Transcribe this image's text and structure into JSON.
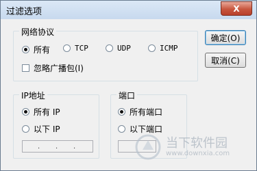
{
  "window": {
    "title": "过滤选项",
    "close_label": "X"
  },
  "protocol_group": {
    "legend": "网络协议",
    "options": [
      {
        "label": "所有",
        "selected": true
      },
      {
        "label": "TCP",
        "selected": false
      },
      {
        "label": "UDP",
        "selected": false
      },
      {
        "label": "ICMP",
        "selected": false
      }
    ],
    "ignore_broadcast_label": "忽略广播包(I)",
    "ignore_broadcast_checked": false
  },
  "ip_group": {
    "legend": "IP地址",
    "all_label": "所有 IP",
    "below_label": "以下 IP",
    "all_selected": true,
    "ip_dots": [
      ".",
      ".",
      "."
    ]
  },
  "port_group": {
    "legend": "端口",
    "all_label": "所有端口",
    "below_label": "以下端口",
    "all_selected": true
  },
  "buttons": {
    "ok": "确定(O)",
    "cancel": "取消(C)"
  },
  "watermark": {
    "name": "当下软件园",
    "url": "www.downxia.com"
  }
}
